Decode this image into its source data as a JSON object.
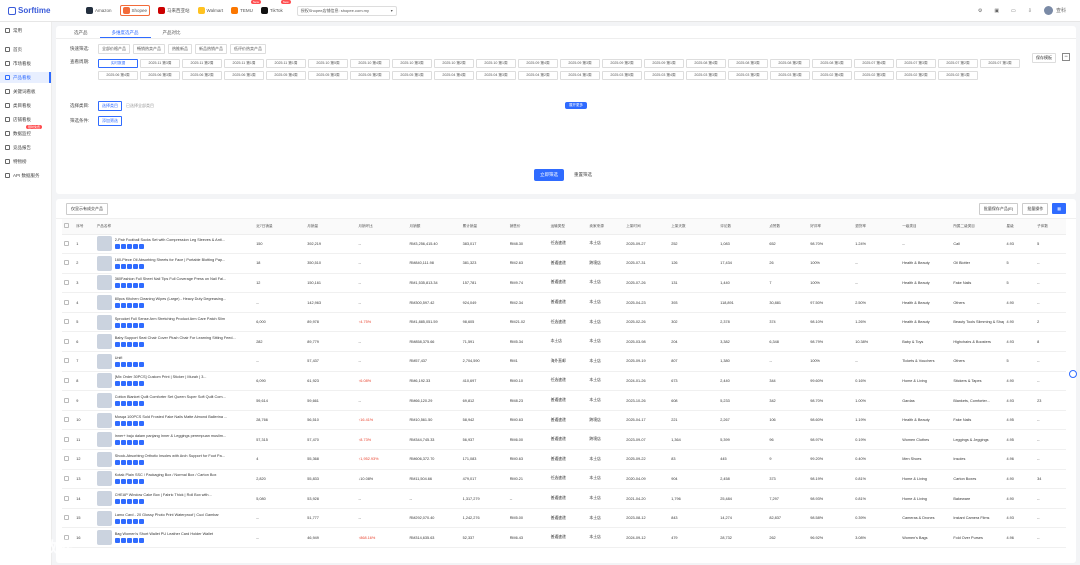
{
  "app": {
    "brand": "Sorftime"
  },
  "platforms": [
    {
      "label": "Amazon",
      "color": "#232f3e",
      "active": false,
      "badge": ""
    },
    {
      "label": "Shopee",
      "color": "#f26b3a",
      "active": true,
      "badge": ""
    },
    {
      "label": "马来西亚站",
      "color": "#cc0000",
      "active": false,
      "badge": ""
    },
    {
      "label": "Walmart",
      "color": "#ffc220",
      "active": false,
      "badge": ""
    },
    {
      "label": "TEMU",
      "color": "#fb7701",
      "active": false,
      "badge": "New"
    },
    {
      "label": "TikTok",
      "color": "#111111",
      "active": false,
      "badge": "New"
    }
  ],
  "shop_selector": "授权Shopee店铺信息: shopee.com.my",
  "user": "查科",
  "sidebar": [
    {
      "label": "常用",
      "hot": ""
    },
    {
      "label": "首页",
      "hot": ""
    },
    {
      "label": "市场看板",
      "hot": ""
    },
    {
      "label": "产品看板",
      "hot": ""
    },
    {
      "label": "关键词看板",
      "hot": ""
    },
    {
      "label": "类目看板",
      "hot": ""
    },
    {
      "label": "店铺看板",
      "hot": ""
    },
    {
      "label": "数据监控",
      "hot": "限时免费"
    },
    {
      "label": "竞品报告",
      "hot": ""
    },
    {
      "label": "特物榜",
      "hot": ""
    },
    {
      "label": "API 数据服务",
      "hot": ""
    }
  ],
  "tabs": [
    "选产品",
    "多维度选产品",
    "产品对比"
  ],
  "quick_label": "快速筛选:",
  "quick": [
    "全部价格产品",
    "畅销热卖产品",
    "热推新品",
    "新品热销产品",
    "低评价热卖产品"
  ],
  "time_label": "查看周期:",
  "time_buttons": [
    "实时数据",
    "2025.11 第3周",
    "2025.11 第2周",
    "2025.11 第1周",
    "2025.11 第1周",
    "2025.10 第5周",
    "2025.10 第4周",
    "2025.10 第3周",
    "2025.10 第2周",
    "2025.10 第1周",
    "2025.09 第4周",
    "2025.09 第3周",
    "2025.09 第2周",
    "2025.09 第1周",
    "2025.08 第4周",
    "2025.08 第3周",
    "2025.08 第2周",
    "2025.08 第1周",
    "2025.07 第4周",
    "2025.07 第3周",
    "2025.07 第2周",
    "2025.07 第1周",
    "2025.06 第4周",
    "2025.06 第3周",
    "2025.06 第2周",
    "2025.06 第1周",
    "2025.05 第4周",
    "2025.05 第3周",
    "2025.05 第2周",
    "2025.05 第1周",
    "2025.04 第4周",
    "2025.04 第3周",
    "2025.04 第2周",
    "2025.04 第1周",
    "2025.03 第5周",
    "2025.03 第4周",
    "2025.03 第3周",
    "2025.03 第2周",
    "2025.03 第1周",
    "2025.02 第4周",
    "2025.02 第3周",
    "2025.02 第2周",
    "2025.02 第1周"
  ],
  "expand": "展开更多",
  "category_label": "选择类目:",
  "category_btn": "选择类目",
  "category_hint": "已选择全部类目",
  "more_label": "筛选条件:",
  "more_btn": "添加筛选",
  "save_opt": "保存模板",
  "actions": {
    "search": "立即筛选",
    "reset": "重置筛选"
  },
  "table_tools": {
    "left": "仅显示有成交产品",
    "export": "批量保存产品(E)",
    "batch": "批量操作"
  },
  "columns": [
    "序号",
    "产品名称",
    "近7日销量",
    "月销量",
    "月销环比",
    "月销额",
    "累计销量",
    "销售价",
    "运输类型",
    "卖家来源",
    "上架时间",
    "上架天数",
    "评论数",
    "点赞数",
    "好评率",
    "退货率",
    "一级类目",
    "所属二级类目",
    "星级",
    "子体数"
  ],
  "rows": [
    [
      "1",
      "2-Pair Football Socks Set with Compression Leg Sleeves & Anti...",
      "150",
      "392,219",
      "--",
      "RM3,256,415.40",
      "383,017",
      "RM8.30",
      "任选速递",
      "本土店",
      "2025-09-27",
      "252",
      "1,083",
      "652",
      "98.70%",
      "1.24%",
      "--",
      "Call",
      "4.93",
      "5"
    ],
    [
      "2",
      "160-Piece Oil Absorbing Sheets for Face | Portable Blotting Pap...",
      "18",
      "350,510",
      "--",
      "RM840,111.98",
      "381,323",
      "RM2.63",
      "普通速递",
      "跨境店",
      "2025-07-31",
      "126",
      "17,434",
      "26",
      "100%",
      "--",
      "Health & Beauty",
      "Oil Blotter",
      "5",
      "--"
    ],
    [
      "3",
      "360Fashion Full Sheet Nail Tips Full Coverage Press on Nail Fal...",
      "12",
      "150,161",
      "--",
      "RM1,535,813.34",
      "157,781",
      "RM9.74",
      "普通速递",
      "本土店",
      "2025-07-26",
      "131",
      "1,440",
      "7",
      "100%",
      "--",
      "Health & Beauty",
      "Fake Nails",
      "5",
      "--"
    ],
    [
      "4",
      "80pcs Kitchen Cleaning Wipes (Large) - Heavy Duty Degreasing...",
      "--",
      "142,963",
      "--",
      "RM300,597.42",
      "924,049",
      "RM2.34",
      "普通速递",
      "本土店",
      "2025-04-23",
      "393",
      "118,891",
      "30,881",
      "97.50%",
      "2.50%",
      "Health & Beauty",
      "Others",
      "4.90",
      "--"
    ],
    [
      "5",
      "Sprocket Full Sense Arm Stretching Product Arm Care Patch Slim",
      "6,000",
      "89,978",
      "↑4.75%",
      "RM1,885,051.59",
      "98,605",
      "RM21.02",
      "任选速递",
      "本土店",
      "2025-02-26",
      "302",
      "2,378",
      "374",
      "98.10%",
      "1.26%",
      "Health & Beauty",
      "Beauty Tools Slimming & Shaping",
      "4.90",
      "2"
    ],
    [
      "6",
      "Baby Support Seat Chair Cover Plush Chair For Learning Sitting Feed...",
      "282",
      "89,779",
      "--",
      "RM858,375.66",
      "71,591",
      "RM5.34",
      "本土店",
      "本土店",
      "2025-03-98",
      "204",
      "3,382",
      "6,348",
      "98.79%",
      "10.38%",
      "Baby & Toys",
      "Highchairs & Boosters",
      "4.93",
      "8"
    ],
    [
      "7",
      "Unifi",
      "--",
      "57,437",
      "--",
      "RM57,437",
      "2,704,590",
      "RM1",
      "海外直邮",
      "本土店",
      "2025-09-19",
      "807",
      "1,380",
      "--",
      "100%",
      "--",
      "Tickets & Vouchers",
      "Others",
      "5",
      "--"
    ],
    [
      "8",
      "[Mix Order 30PCS] Custom Print | Sticker | Murah | 3...",
      "6,090",
      "61,923",
      "↑6.08%",
      "RM6,192.33",
      "410,697",
      "RM0.10",
      "任选速递",
      "本土店",
      "2024-01-26",
      "673",
      "2,440",
      "344",
      "99.60%",
      "0.16%",
      "Home & Living",
      "Stickers & Tapes",
      "4.90",
      "--"
    ],
    [
      "9",
      "Cotton Blanket Quilt Comforter Set Queen Super Soft Quilt Com...",
      "59,614",
      "59,661",
      "--",
      "RM66,120.29",
      "69,812",
      "RM8.23",
      "普通速递",
      "本土店",
      "2023-10-26",
      "608",
      "5,233",
      "342",
      "98.70%",
      "1.00%",
      "Gardas",
      "Blankets, Comforter...",
      "4.93",
      "23"
    ],
    [
      "10",
      "Mosqa 100PCS Sold Frosted Fake Nails Matte Almond Ballerina ...",
      "28,766",
      "56,510",
      "↑16.41%",
      "RM10,561.50",
      "58,942",
      "RM0.63",
      "普通速递",
      "跨境店",
      "2025-04-17",
      "221",
      "2,267",
      "106",
      "98.60%",
      "1.19%",
      "Health & Beauty",
      "Fake Nails",
      "4.95",
      "--"
    ],
    [
      "11",
      "Inner+ baju dalam panjang Inner & Leggings perempuan muslim...",
      "57,315",
      "57,470",
      "↑8.73%",
      "RM344,745.33",
      "56,937",
      "RM6.00",
      "普通速递",
      "跨境店",
      "2023-09-07",
      "1,364",
      "5,399",
      "96",
      "98.97%",
      "0.19%",
      "Women Clothes",
      "Leggings & Jeggings",
      "4.95",
      "--"
    ],
    [
      "12",
      "Shock-Absorbing Orthotic Insoles with Arch Support for Foot Pa...",
      "4",
      "55,368",
      "↑1,952.93%",
      "RM606,372.70",
      "171,083",
      "RM0.63",
      "普通速递",
      "本土店",
      "2025-09-22",
      "83",
      "445",
      "9",
      "99.20%",
      "0.40%",
      "Men Shoes",
      "Insoles",
      "4.96",
      "--"
    ],
    [
      "13",
      "Kotak Plain SSC / Packaging Box / Normal Box / Carton Box",
      "2,820",
      "55,833",
      "↓10.08%",
      "RM11,504.66",
      "479,017",
      "RM0.21",
      "任选速递",
      "本土店",
      "2020-04-09",
      "904",
      "2,458",
      "373",
      "98.19%",
      "0.81%",
      "Home & Living",
      "Carton Boxes",
      "4.90",
      "34"
    ],
    [
      "14",
      "CHEAP Window Cake Box | Fabric Thick | Roll Box with...",
      "5,080",
      "53,928",
      "--",
      "--",
      "1,317,279",
      "--",
      "普通速递",
      "本土店",
      "2021-04-20",
      "1,796",
      "25,484",
      "7,297",
      "98.93%",
      "0.81%",
      "Home & Living",
      "Bakeware",
      "4.90",
      "--"
    ],
    [
      "15",
      "Lamo Card - 20 Glossy Photo Print Waterproof | Cuci Gambar",
      "--",
      "51,777",
      "--",
      "RM292,070.40",
      "1,242,276",
      "RM5.00",
      "普通速递",
      "本土店",
      "2023-08-12",
      "843",
      "14,274",
      "82,837",
      "98.58%",
      "0.39%",
      "Cameras & Drones",
      "Instant Camera Films",
      "4.93",
      "--"
    ],
    [
      "16",
      "Bag Women's Short Wallet PU Leather Card Holder Wallet",
      "--",
      "46,949",
      "↑868.16%",
      "RM314,635.63",
      "52,337",
      "RM6.43",
      "普通速递",
      "本土店",
      "2024-09-12",
      "479",
      "28,732",
      "262",
      "96.92%",
      "3.08%",
      "Women's Bags",
      "Fold Over Purses",
      "4.96",
      "--"
    ]
  ]
}
